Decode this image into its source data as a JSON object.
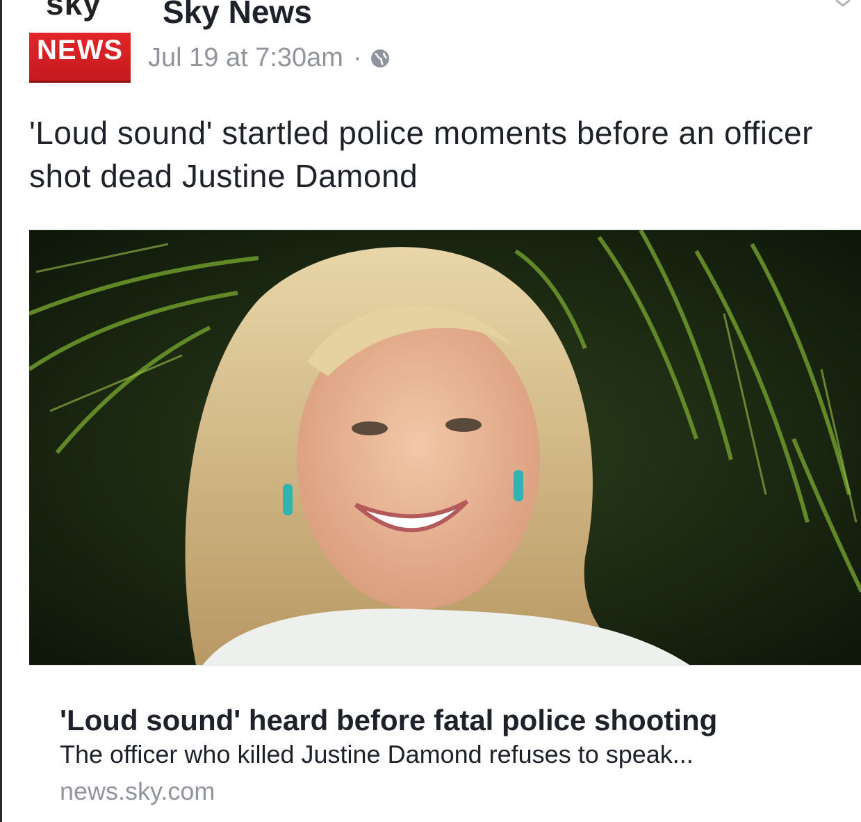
{
  "post": {
    "page_name": "Sky News",
    "logo": {
      "top_text": "sky",
      "badge_text": "NEWS",
      "badge_color": "#d62026"
    },
    "timestamp": "Jul 19 at 7:30am",
    "separator": "·",
    "audience_icon": "globe-icon",
    "options_icon": "chevron-down-icon",
    "status_text": "'Loud sound' startled police moments before an officer shot dead Justine Damond"
  },
  "link_preview": {
    "image_description_icon": "article-photo",
    "title": "'Loud sound' heard before fatal police shooting",
    "description": "The officer who killed Justine Damond refuses to speak...",
    "domain": "news.sky.com"
  },
  "colors": {
    "text_primary": "#1d2129",
    "text_secondary": "#90949c",
    "brand_red": "#d62026"
  }
}
